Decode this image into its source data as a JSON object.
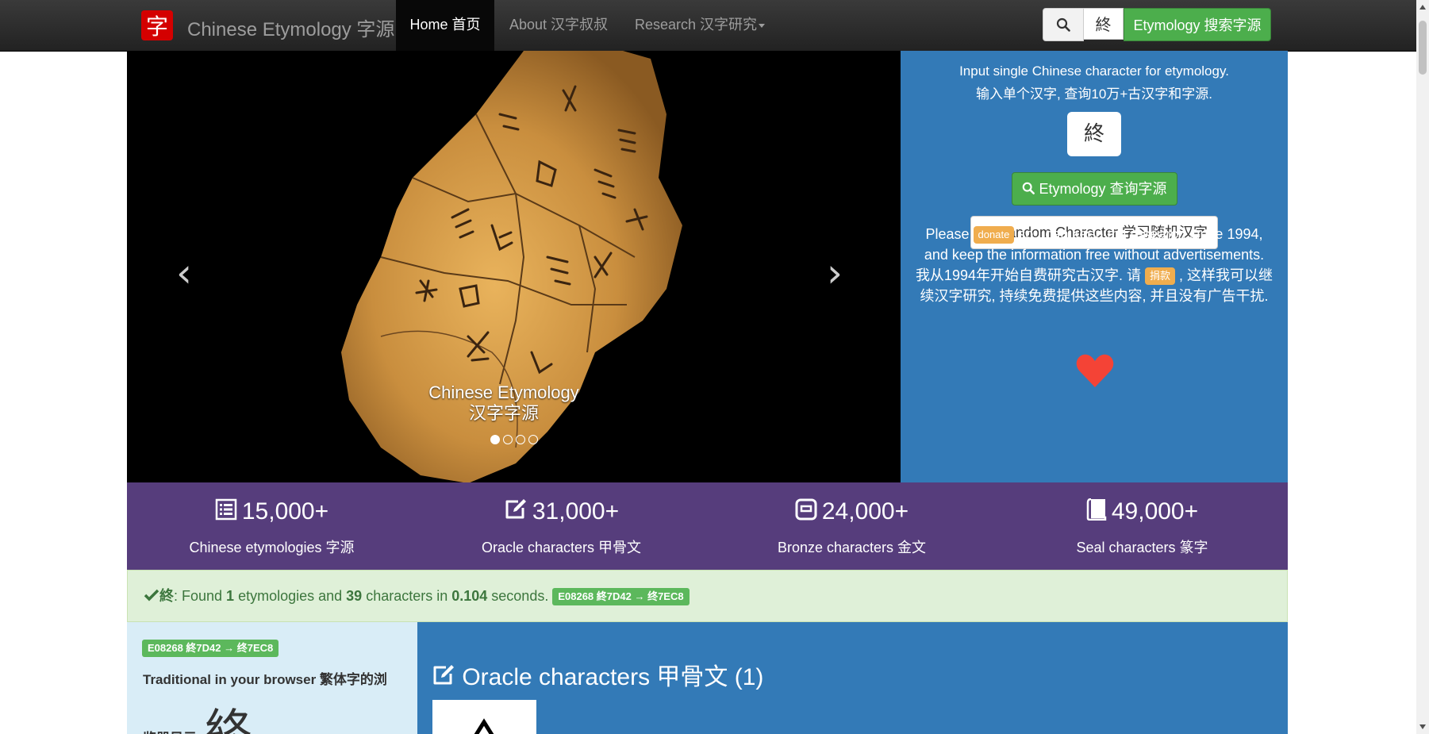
{
  "nav": {
    "logo_char": "字",
    "brand": "Chinese Etymology 字源",
    "home": "Home 首页",
    "about": "About 汉字叔叔",
    "research": "Research 汉字研究",
    "search_value": "終",
    "etym_button": "Etymology 搜索字源"
  },
  "carousel": {
    "caption_line1": "Chinese Etymology",
    "caption_line2": "汉字字源",
    "prev": "‹",
    "next": "›",
    "slides": 4,
    "active_slide": 1
  },
  "search_panel": {
    "intro_en": "Input single Chinese character for etymology.",
    "intro_cn": "输入单个汉字, 查询10万+古汉字和字源.",
    "input_value": "終",
    "etym_button": "Etymology 查询字源",
    "random_button": "Random Character 学习随机汉字",
    "donate_pre": "Please",
    "donate_badge": "donate",
    "donate_post": "so I can keep my research since 1994,",
    "donate_line2": "and keep the information free without advertisements.",
    "cn_line1_pre": "我从1994年开始自费研究古汉字. 请",
    "cn_badge": "捐款",
    "cn_line1_post": ", 这样我可以继",
    "cn_line2": "续汉字研究, 持续免费提供这些内容, 并且没有广告干扰."
  },
  "stats": [
    {
      "value": "15,000+",
      "label": "Chinese etymologies 字源",
      "icon": "list-icon"
    },
    {
      "value": "31,000+",
      "label": "Oracle characters 甲骨文",
      "icon": "edit-icon"
    },
    {
      "value": "24,000+",
      "label": "Bronze characters 金文",
      "icon": "bronze-icon"
    },
    {
      "value": "49,000+",
      "label": "Seal characters 篆字",
      "icon": "book-icon"
    }
  ],
  "result": {
    "char": "終",
    "t1": ": Found ",
    "etym_count": "1",
    "t2": " etymologies and ",
    "char_count": "39",
    "t3": " characters in ",
    "seconds": "0.104",
    "t4": " seconds.",
    "code_label": "E08268 終7D42 → 终7EC8"
  },
  "left_info": {
    "code_label": "E08268 終7D42 → 终7EC8",
    "text": "Traditional in your browser 繁体字的浏",
    "text2": "览器显示:",
    "big_char": "終"
  },
  "oracle": {
    "title": "Oracle characters 甲骨文 (1)"
  },
  "colors": {
    "nav_bg": "#222222",
    "blue": "#337ab7",
    "purple": "#563d7c",
    "green": "#5cb85c",
    "alert_bg": "#dff0d8",
    "orange": "#f0ad4e",
    "heart": "#f44336"
  }
}
